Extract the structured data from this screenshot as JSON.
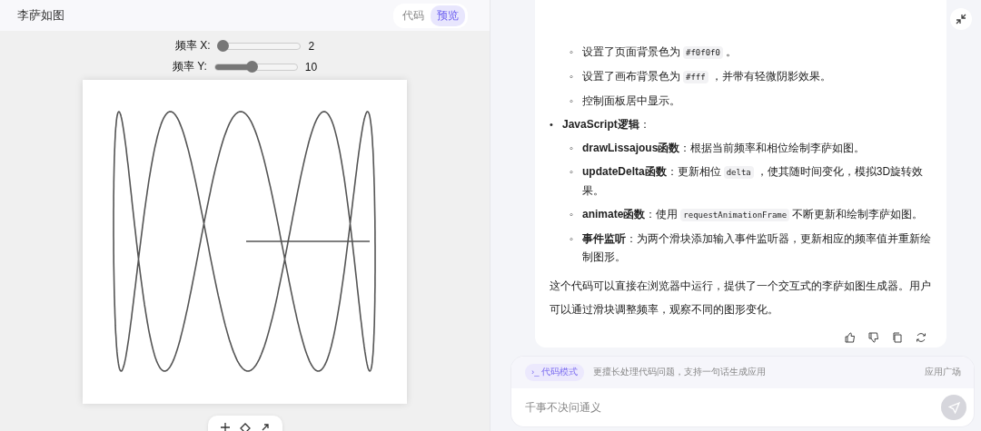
{
  "preview_panel": {
    "title": "李萨如图",
    "tabs": [
      {
        "label": "代码",
        "selected": false
      },
      {
        "label": "预览",
        "selected": true
      }
    ],
    "sliders": [
      {
        "label": "频率 X:",
        "level": 0.05,
        "reading": "2"
      },
      {
        "label": "频率 Y:",
        "level": 0.45,
        "reading": "10"
      }
    ]
  },
  "chat": {
    "outline": [
      {
        "children": [
          {
            "marker": "◦",
            "parts": [
              {
                "kind": "text",
                "text": "设置了页面背景色为"
              },
              {
                "kind": "code",
                "text": "#f0f0f0"
              },
              {
                "kind": "text",
                "text": "。"
              }
            ]
          },
          {
            "marker": "◦",
            "parts": [
              {
                "kind": "text",
                "text": "设置了画布背景色为"
              },
              {
                "kind": "code",
                "text": "#fff"
              },
              {
                "kind": "text",
                "text": "，并带有轻微阴影效果。"
              }
            ]
          },
          {
            "marker": "◦",
            "parts": [
              {
                "kind": "text",
                "text": "控制面板居中显示。"
              }
            ]
          }
        ]
      },
      {
        "marker": "•",
        "parts": [
          {
            "kind": "text",
            "text": "**JavaScript逻辑**："
          }
        ],
        "children": [
          {
            "marker": "◦",
            "parts": [
              {
                "kind": "text",
                "text": "**drawLissajous函数**：根据当前频率和相位绘制李萨如图。"
              }
            ]
          },
          {
            "marker": "◦",
            "parts": [
              {
                "kind": "text",
                "text": "**updateDelta函数**：更新相位"
              },
              {
                "kind": "code",
                "text": "delta"
              },
              {
                "kind": "text",
                "text": "，使其随时间变化，模拟3D旋转效果。"
              }
            ]
          },
          {
            "marker": "◦",
            "parts": [
              {
                "kind": "text",
                "text": "**animate函数**：使用"
              },
              {
                "kind": "code",
                "text": "requestAnimationFrame"
              },
              {
                "kind": "text",
                "text": "不断更新和绘制李萨如图。"
              }
            ]
          },
          {
            "marker": "◦",
            "parts": [
              {
                "kind": "text",
                "text": "**事件监听**：为两个滑块添加输入事件监听器，更新相应的频率值并重新绘制图形。"
              }
            ]
          }
        ]
      }
    ],
    "summary": "这个代码可以直接在浏览器中运行，提供了一个交互式的李萨如图生成器。用户可以通过滑块调整频率，观察不同的图形变化。"
  },
  "composer": {
    "mode_chip": "代码模式",
    "mode_icon": "›_",
    "hint": "更擅长处理代码问题，支持一句话生成应用",
    "app_link": "应用广场",
    "placeholder": "千事不决问通义"
  }
}
